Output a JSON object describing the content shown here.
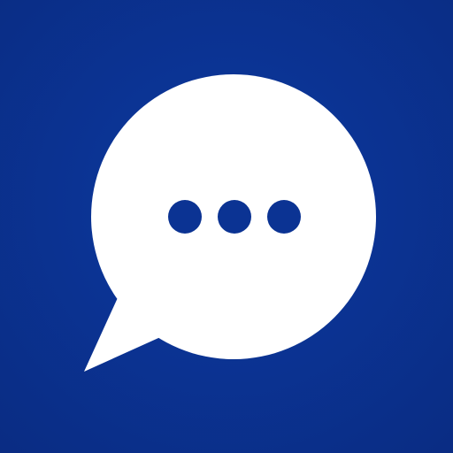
{
  "icon": {
    "name": "chat-bubble-typing-icon",
    "background_color": "#0b3393",
    "bubble_color": "#ffffff",
    "dot_color": "#0b3393",
    "dot_count": 3
  }
}
